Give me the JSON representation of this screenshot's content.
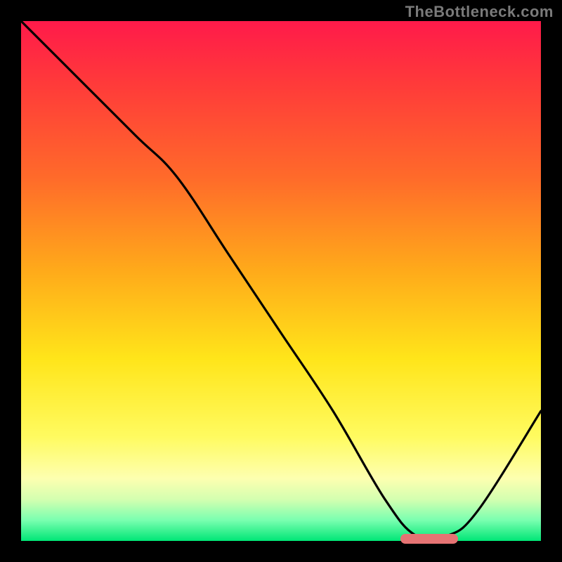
{
  "watermark": "TheBottleneck.com",
  "colors": {
    "top": "#ff1a4a",
    "bottom": "#00e676",
    "curve": "#000000",
    "marker": "#e57373",
    "background": "#000000",
    "watermark_text": "#7a7a7a"
  },
  "chart_data": {
    "type": "line",
    "title": "",
    "xlabel": "",
    "ylabel": "",
    "xlim": [
      0,
      100
    ],
    "ylim": [
      0,
      100
    ],
    "grid": false,
    "legend": false,
    "background_gradient": "vertical red→orange→yellow→green (bottleneck heatmap)",
    "series": [
      {
        "name": "bottleneck-curve",
        "x": [
          0,
          10,
          22,
          30,
          40,
          50,
          60,
          70,
          76,
          82,
          88,
          100
        ],
        "y": [
          100,
          90,
          78,
          70,
          55,
          40,
          25,
          8,
          1,
          1,
          6,
          25
        ]
      }
    ],
    "optimal_marker": {
      "x_start": 73,
      "x_end": 84,
      "y": 0
    },
    "annotations": []
  }
}
